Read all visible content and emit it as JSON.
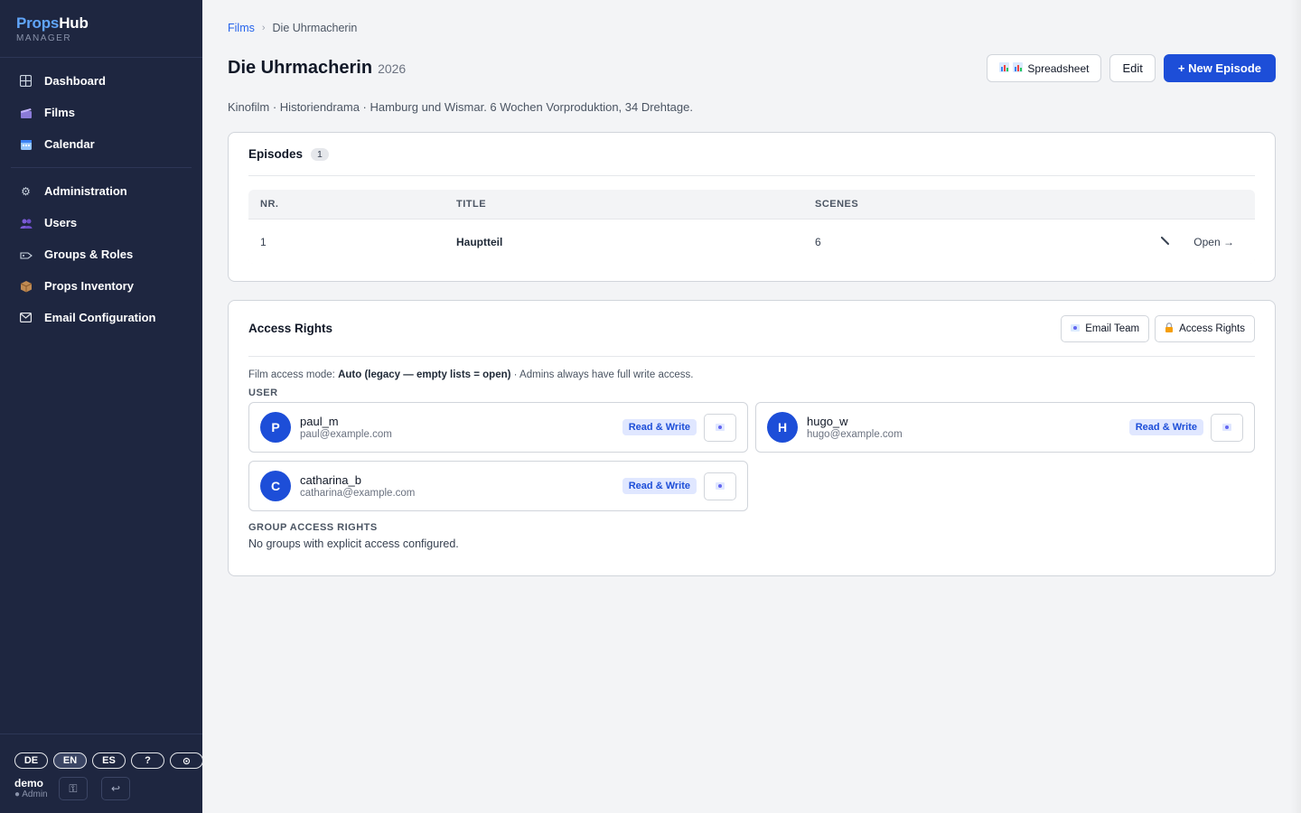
{
  "brand": {
    "name_prefix": "Props",
    "name_suffix": "Hub",
    "subtitle": "MANAGER"
  },
  "nav": {
    "primary": [
      {
        "label": "Dashboard",
        "icon": "grid-icon"
      },
      {
        "label": "Films",
        "icon": "clapper-icon"
      },
      {
        "label": "Calendar",
        "icon": "calendar-icon"
      }
    ],
    "admin": [
      {
        "label": "Administration",
        "icon": "gear-icon"
      },
      {
        "label": "Users",
        "icon": "users-icon"
      },
      {
        "label": "Groups & Roles",
        "icon": "tag-icon"
      },
      {
        "label": "Props Inventory",
        "icon": "package-icon"
      },
      {
        "label": "Email Configuration",
        "icon": "mail-icon"
      }
    ]
  },
  "footer": {
    "languages": [
      "DE",
      "EN",
      "ES"
    ],
    "active_language": "EN",
    "help": "?",
    "theme": "⊙",
    "user_name": "demo",
    "user_role": "● Admin"
  },
  "breadcrumb": {
    "parent": "Films",
    "current": "Die Uhrmacherin"
  },
  "header": {
    "title": "Die Uhrmacherin",
    "year": "2026",
    "spreadsheet_label": "Spreadsheet",
    "edit_label": "Edit",
    "new_episode_label": "+ New Episode"
  },
  "description": "Kinofilm · Historiendrama · Hamburg und Wismar. 6 Wochen Vorproduktion, 34 Drehtage.",
  "episodes": {
    "title": "Episodes",
    "count": "1",
    "columns": [
      "NR.",
      "TITLE",
      "SCENES"
    ],
    "rows": [
      {
        "nr": "1",
        "title": "Hauptteil",
        "scenes": "6",
        "open_label": "Open →"
      }
    ]
  },
  "access": {
    "title": "Access Rights",
    "email_team_label": "Email Team",
    "access_rights_label": "Access Rights",
    "mode_prefix": "Film access mode:",
    "mode_value": "Auto (legacy — empty lists = open)",
    "mode_suffix": "· Admins always have full write access.",
    "user_section": "USER",
    "users": [
      {
        "initial": "P",
        "name": "paul_m",
        "email": "paul@example.com",
        "permission": "Read & Write"
      },
      {
        "initial": "H",
        "name": "hugo_w",
        "email": "hugo@example.com",
        "permission": "Read & Write"
      },
      {
        "initial": "C",
        "name": "catharina_b",
        "email": "catharina@example.com",
        "permission": "Read & Write"
      }
    ],
    "group_section": "GROUP ACCESS RIGHTS",
    "group_empty": "No groups with explicit access configured."
  },
  "colors": {
    "sidebar": "#1e2640",
    "accent": "#1d4ed8",
    "brand_accent": "#60a5fa"
  }
}
